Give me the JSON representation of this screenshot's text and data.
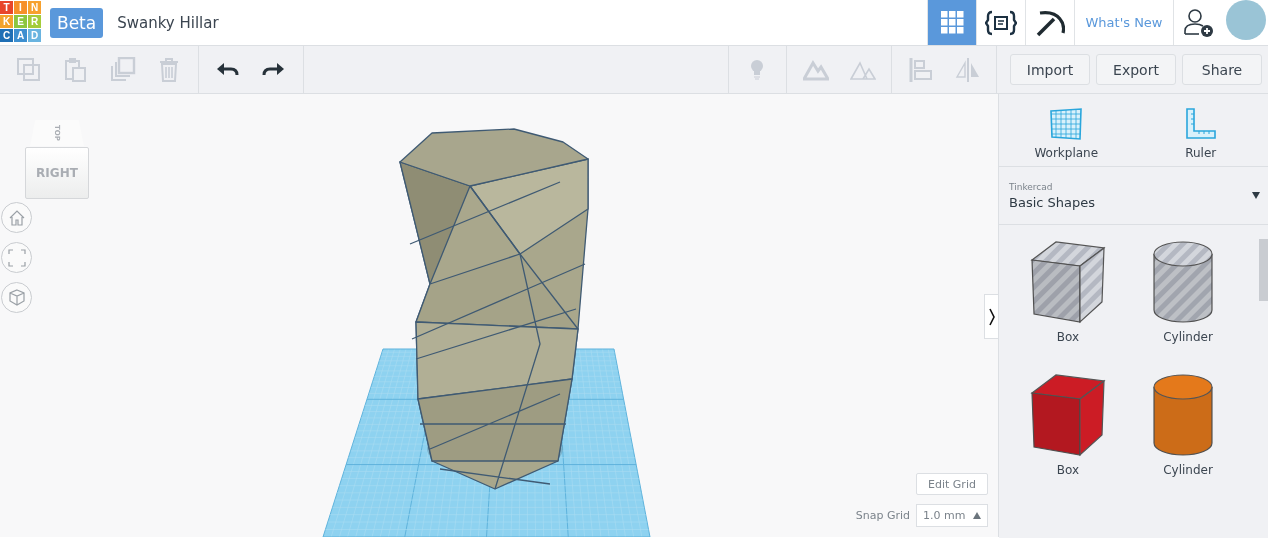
{
  "logo": {
    "letters": [
      {
        "text": "T",
        "color": "#e8462b"
      },
      {
        "text": "I",
        "color": "#f6902a"
      },
      {
        "text": "N",
        "color": "#f7a12e"
      },
      {
        "text": "K",
        "color": "#f3a32c"
      },
      {
        "text": "E",
        "color": "#8cc63f"
      },
      {
        "text": "R",
        "color": "#a4cc3a"
      },
      {
        "text": "C",
        "color": "#1f6fb5"
      },
      {
        "text": "A",
        "color": "#3d8fd0"
      },
      {
        "text": "D",
        "color": "#6ab4e0"
      }
    ]
  },
  "header": {
    "badge": "Beta",
    "title": "Swanky Hillar",
    "nav": [
      {
        "kind": "grid",
        "selected": true
      },
      {
        "kind": "code",
        "selected": false
      },
      {
        "kind": "pickaxe",
        "selected": false
      },
      {
        "kind": "link",
        "label": "What's New",
        "selected": false
      },
      {
        "kind": "add_user",
        "selected": false
      },
      {
        "kind": "avatar",
        "selected": false
      }
    ]
  },
  "toolbar": {
    "left": [
      {
        "kind": "copy",
        "disabled": true
      },
      {
        "kind": "paste",
        "disabled": true
      },
      {
        "kind": "duplicate",
        "disabled": true
      },
      {
        "kind": "delete",
        "disabled": true
      },
      {
        "kind": "undo",
        "disabled": false
      },
      {
        "kind": "redo",
        "disabled": false
      }
    ],
    "right": [
      {
        "kind": "light",
        "disabled": true
      },
      {
        "kind": "solid",
        "disabled": true
      },
      {
        "kind": "hole",
        "disabled": true
      },
      {
        "kind": "align",
        "disabled": true
      },
      {
        "kind": "mirror",
        "disabled": true
      }
    ],
    "buttons": [
      "Import",
      "Export",
      "Share"
    ]
  },
  "viewcube": {
    "top": "TOP",
    "side": "RIGHT"
  },
  "view_controls": [
    {
      "kind": "home"
    },
    {
      "kind": "fit"
    },
    {
      "kind": "perspective"
    }
  ],
  "grid": {
    "edit_button": "Edit Grid",
    "snap_label": "Snap Grid",
    "snap_value": "1.0 mm"
  },
  "sidebar": {
    "tools": [
      {
        "kind": "workplane",
        "label": "Workplane"
      },
      {
        "kind": "ruler",
        "label": "Ruler"
      }
    ],
    "library": {
      "source": "Tinkercad",
      "category": "Basic Shapes"
    },
    "shapes": [
      {
        "kind": "box",
        "label": "Box",
        "hole": true,
        "color": "#b4b8c2"
      },
      {
        "kind": "cylinder",
        "label": "Cylinder",
        "hole": true,
        "color": "#b4b8c2"
      },
      {
        "kind": "box",
        "label": "Box",
        "hole": false,
        "color": "#cc1c25"
      },
      {
        "kind": "cylinder",
        "label": "Cylinder",
        "hole": false,
        "color": "#e4791b"
      }
    ]
  }
}
